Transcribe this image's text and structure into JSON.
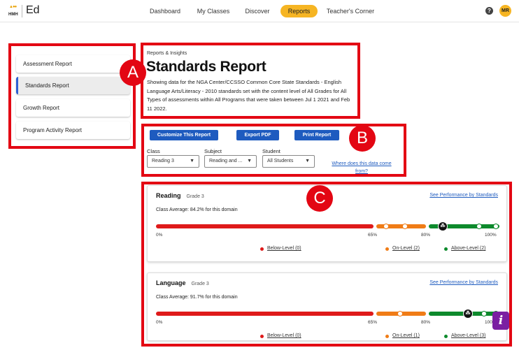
{
  "brand": {
    "logo_text": "HMH",
    "app_name": "Ed"
  },
  "nav": [
    {
      "label": "Dashboard",
      "active": false
    },
    {
      "label": "My Classes",
      "active": false
    },
    {
      "label": "Discover",
      "active": false
    },
    {
      "label": "Reports",
      "active": true
    },
    {
      "label": "Teacher's Corner",
      "active": false
    }
  ],
  "user": {
    "help": "?",
    "initials": "MR"
  },
  "annotations": {
    "a": "A",
    "b": "B",
    "c": "C",
    "color": "#e30613"
  },
  "sidebar": {
    "items": [
      {
        "label": "Assessment Report",
        "active": false
      },
      {
        "label": "Standards Report",
        "active": true
      },
      {
        "label": "Growth Report",
        "active": false
      },
      {
        "label": "Program Activity Report",
        "active": false
      }
    ]
  },
  "header": {
    "breadcrumb": "Reports & Insights",
    "title": "Standards Report",
    "description": "Showing data for the NGA Center/CCSSO Common Core State Standards - English Language Arts/Literacy - 2010 standards set with the content level of All Grades for All Types of assessments within All Programs that were taken between Jul 1 2021 and Feb 11 2022."
  },
  "actions": {
    "customize": "Customize This Report",
    "export": "Export PDF",
    "print": "Print Report"
  },
  "filters": {
    "class": {
      "label": "Class",
      "value": "Reading 3"
    },
    "subject": {
      "label": "Subject",
      "value": "Reading and ..."
    },
    "student": {
      "label": "Student",
      "value": "All Students"
    },
    "help_link": "Where does this data come from?"
  },
  "colors": {
    "below": "#df1a1a",
    "on": "#f07c16",
    "above": "#0d8a2c",
    "accent": "#1e5bbf",
    "reports_pill": "#f6b523"
  },
  "domains": [
    {
      "title": "Reading",
      "grade": "Grade 3",
      "link": "See Performance by Standards",
      "average": "Class Average: 84.2% for this domain",
      "class_average_percent": 84.2,
      "ticks": {
        "min": "0%",
        "low": "65%",
        "mid": "80%",
        "max": "100%"
      },
      "legend": {
        "below": "Below-Level (0)",
        "on": "On-Level (2)",
        "above": "Above-Level (2)"
      }
    },
    {
      "title": "Language",
      "grade": "Grade 3",
      "link": "See Performance by Standards",
      "average": "Class Average: 91.7% for this domain",
      "class_average_percent": 91.7,
      "ticks": {
        "min": "0%",
        "low": "65%",
        "mid": "80%",
        "max": "100%"
      },
      "legend": {
        "below": "Below-Level (0)",
        "on": "On-Level (1)",
        "above": "Above-Level (3)"
      }
    }
  ],
  "info_button": "i"
}
